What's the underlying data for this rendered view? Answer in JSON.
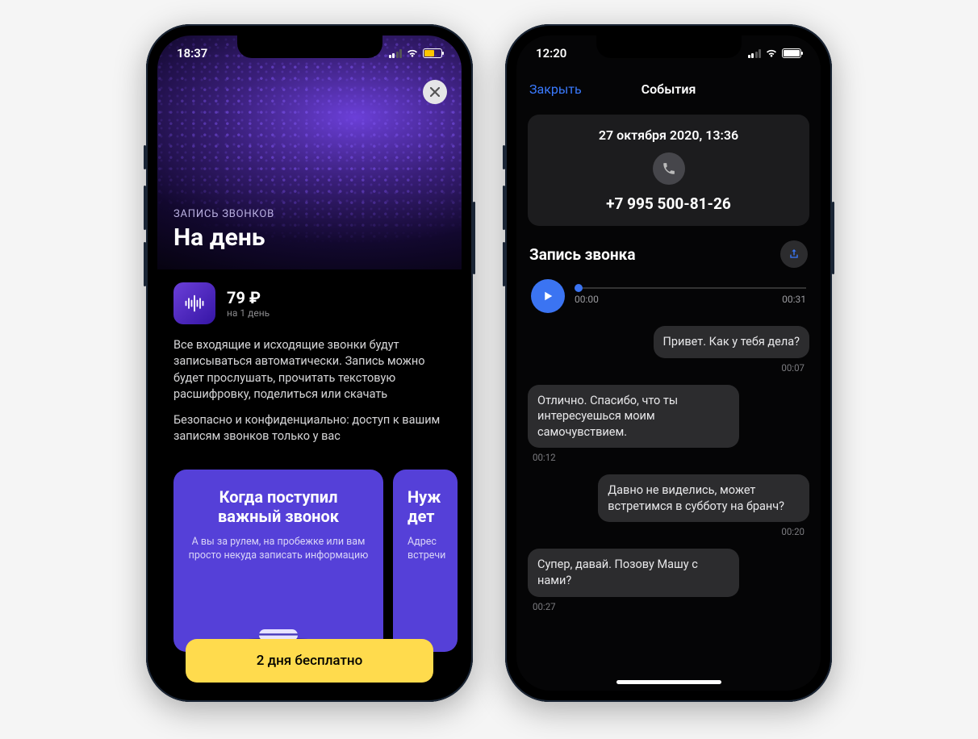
{
  "left": {
    "status_time": "18:37",
    "hero_eyebrow": "ЗАПИСЬ ЗВОНКОВ",
    "hero_title": "На день",
    "price": "79 ₽",
    "price_period": "на 1 день",
    "desc_1": "Все входящие и исходящие звонки будут записываться автоматически. Запись можно будет прослушать, прочитать текстовую расшифровку, поделиться или скачать",
    "desc_2": "Безопасно и конфиденциально: доступ к вашим записям звонков только у вас",
    "card1_title": "Когда поступил важный звонок",
    "card1_sub": "А вы за рулем, на пробежке или вам просто некуда записать информацию",
    "card2_title_1": "Нуж",
    "card2_title_2": "дет",
    "card2_sub_1": "Адрес",
    "card2_sub_2": "встречи",
    "cta": "2 дня бесплатно"
  },
  "right": {
    "status_time": "12:20",
    "nav_close": "Закрыть",
    "nav_title": "События",
    "call_date": "27 октября 2020, 13:36",
    "call_number": "+7 995 500-81-26",
    "section_title": "Запись звонка",
    "player_start": "00:00",
    "player_end": "00:31",
    "messages": [
      {
        "side": "right",
        "text": "Привет. Как у тебя дела?",
        "time": "00:07"
      },
      {
        "side": "left",
        "text": "Отлично. Спасибо, что ты интересуешься моим самочувствием.",
        "time": "00:12"
      },
      {
        "side": "right",
        "text": "Давно не виделись, может встретимся в субботу на бранч?",
        "time": "00:20"
      },
      {
        "side": "left",
        "text": "Супер, давай. Позову Машу с нами?",
        "time": "00:27"
      }
    ]
  }
}
